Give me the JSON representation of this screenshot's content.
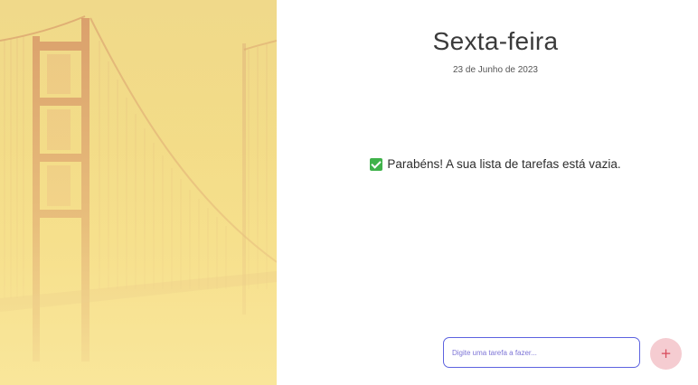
{
  "header": {
    "day": "Sexta-feira",
    "date": "23 de Junho de 2023"
  },
  "empty_state": {
    "icon": "check-box-icon",
    "message": "Parabéns! A sua lista de tarefas está vazia."
  },
  "new_task": {
    "placeholder": "Digite uma tarefa a fazer...",
    "value": ""
  },
  "add_button": {
    "icon": "plus-icon",
    "symbol": "+"
  },
  "background_image": {
    "subject": "golden-gate-bridge-in-fog",
    "overlay_color": "#f6dc7c"
  },
  "colors": {
    "accent_border": "#5d63e0",
    "add_button_bg": "#f5ccd1",
    "add_button_icon": "#d84a5b",
    "check_green": "#3fb24a"
  }
}
